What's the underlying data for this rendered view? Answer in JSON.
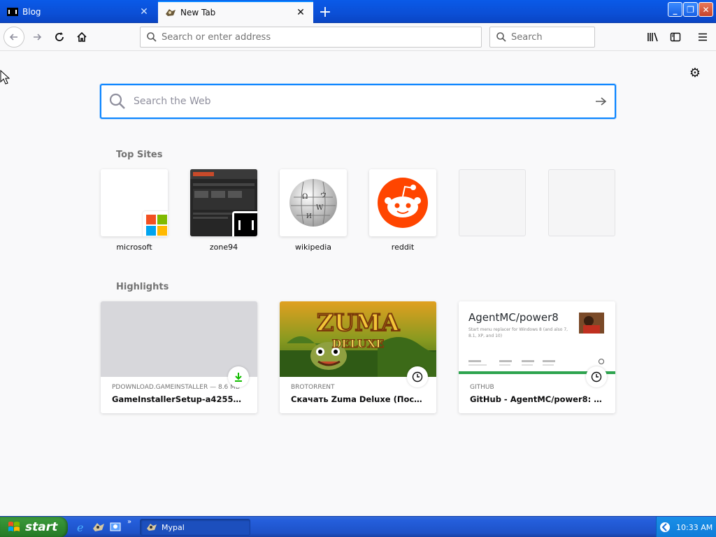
{
  "browser": {
    "tabs": [
      {
        "title": "Blog",
        "active": false
      },
      {
        "title": "New Tab",
        "active": true
      }
    ],
    "url_placeholder": "Search or enter address",
    "search_placeholder": "Search"
  },
  "newtab": {
    "search_placeholder": "Search the Web",
    "top_sites_title": "Top Sites",
    "top_sites": [
      {
        "label": "microsoft"
      },
      {
        "label": "zone94"
      },
      {
        "label": "wikipedia"
      },
      {
        "label": "reddit"
      },
      {
        "label": ""
      },
      {
        "label": ""
      }
    ],
    "highlights_title": "Highlights",
    "highlights": [
      {
        "source": "PDOWNLOAD.GAMEINSTALLER — 8.6 MB",
        "title": "GameInstallerSetup-a425585.exe",
        "badge": "download-icon"
      },
      {
        "source": "BROTORRENT",
        "title": "Скачать Zuma Deluxe (Последн...",
        "badge": "clock-icon",
        "thumb_title": "ZUMA",
        "thumb_subtitle": "DELUXE"
      },
      {
        "source": "GITHUB",
        "title": "GitHub - AgentMC/power8: Star...",
        "badge": "clock-icon",
        "thumb_title": "AgentMC/power8",
        "thumb_desc": "Start menu replacer for Windows 8 (and also 7, 8.1, XP, and 10)"
      }
    ]
  },
  "taskbar": {
    "start_label": "start",
    "task_label": "Mypal",
    "clock": "10:33 AM"
  },
  "colors": {
    "accent": "#0a84ff",
    "reddit": "#ff4500",
    "xp_blue": "#245edb",
    "start_green": "#2f8a2f"
  }
}
